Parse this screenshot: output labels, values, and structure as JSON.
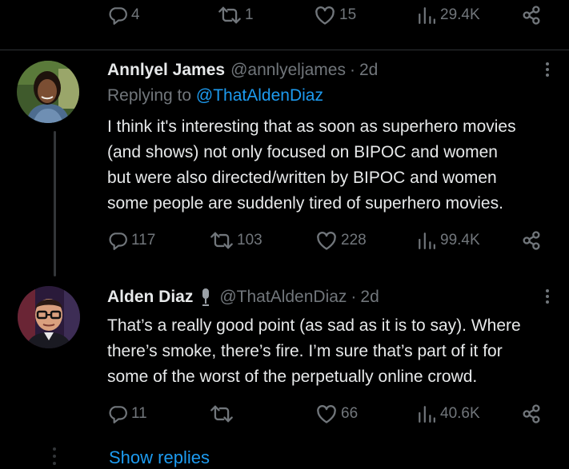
{
  "top_actions": {
    "replies": "4",
    "retweets": "1",
    "likes": "15",
    "views": "29.4K"
  },
  "tweets": [
    {
      "author_name": "Annlyel James",
      "author_handle": "@annlyeljames",
      "separator": "·",
      "time": "2d",
      "replying_prefix": "Replying to",
      "replying_to": "@ThatAldenDiaz",
      "text": "I think it's interesting that as soon as superhero movies\n(and shows) not only focused on BIPOC and women\nbut were also directed/written by BIPOC and women\nsome people are suddenly tired of superhero movies.",
      "actions": {
        "replies": "117",
        "retweets": "103",
        "likes": "228",
        "views": "99.4K"
      }
    },
    {
      "author_name": "Alden Diaz",
      "author_badge_icon": "microphone-icon",
      "author_handle": "@ThatAldenDiaz",
      "separator": "·",
      "time": "2d",
      "text": "That’s a really good point (as sad as it is to say). Where\nthere’s smoke, there’s fire. I’m sure that’s part of it for\nsome of the worst of the perpetually online crowd.",
      "actions": {
        "replies": "11",
        "retweets": "",
        "likes": "66",
        "views": "40.6K"
      }
    }
  ],
  "show_replies_label": "Show replies",
  "colors": {
    "background": "#000000",
    "text_primary": "#e7e9ea",
    "text_secondary": "#71767b",
    "accent": "#1d9bf0",
    "divider": "#2f3336"
  }
}
